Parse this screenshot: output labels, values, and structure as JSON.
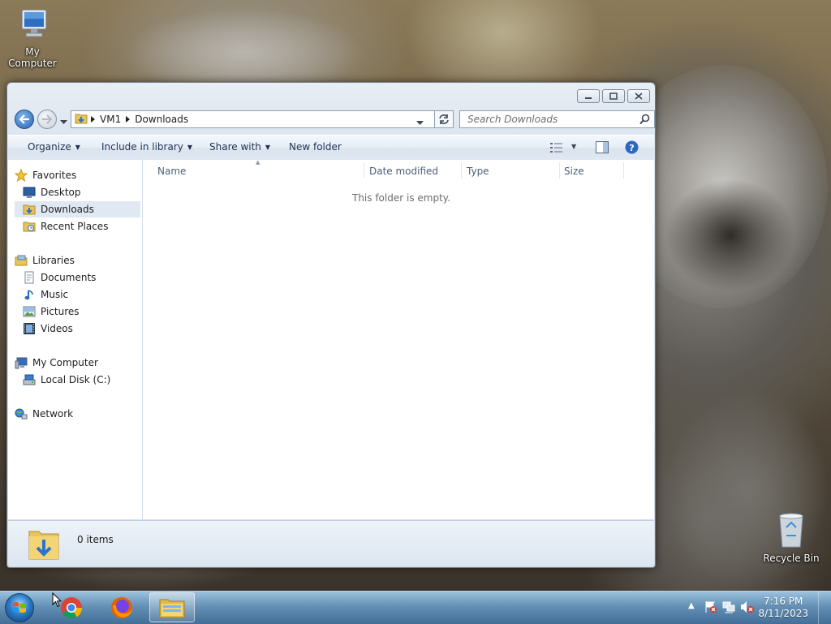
{
  "desktop": {
    "icons": [
      {
        "label": "My Computer",
        "icon": "computer-icon"
      },
      {
        "label": "Recycle Bin",
        "icon": "recycle-bin-icon"
      }
    ]
  },
  "window": {
    "breadcrumb": [
      "VM1",
      "Downloads"
    ],
    "search_placeholder": "Search Downloads",
    "toolbar": {
      "organize": "Organize",
      "include_in_library": "Include in library",
      "share_with": "Share with",
      "new_folder": "New folder"
    },
    "nav": {
      "favorites": "Favorites",
      "desktop": "Desktop",
      "downloads": "Downloads",
      "recent_places": "Recent Places",
      "libraries": "Libraries",
      "documents": "Documents",
      "music": "Music",
      "pictures": "Pictures",
      "videos": "Videos",
      "my_computer": "My Computer",
      "local_disk": "Local Disk (C:)",
      "network": "Network"
    },
    "columns": {
      "name": "Name",
      "date_modified": "Date modified",
      "type": "Type",
      "size": "Size"
    },
    "empty_message": "This folder is empty.",
    "status": "0 items"
  },
  "taskbar": {
    "time": "7:16 PM",
    "date": "8/11/2023",
    "pinned": [
      "chrome-icon",
      "firefox-icon",
      "explorer-icon"
    ]
  },
  "colors": {
    "selection": "#dfe8f3",
    "taskbar": "#5c8bb2",
    "link_text": "#1e3354"
  }
}
